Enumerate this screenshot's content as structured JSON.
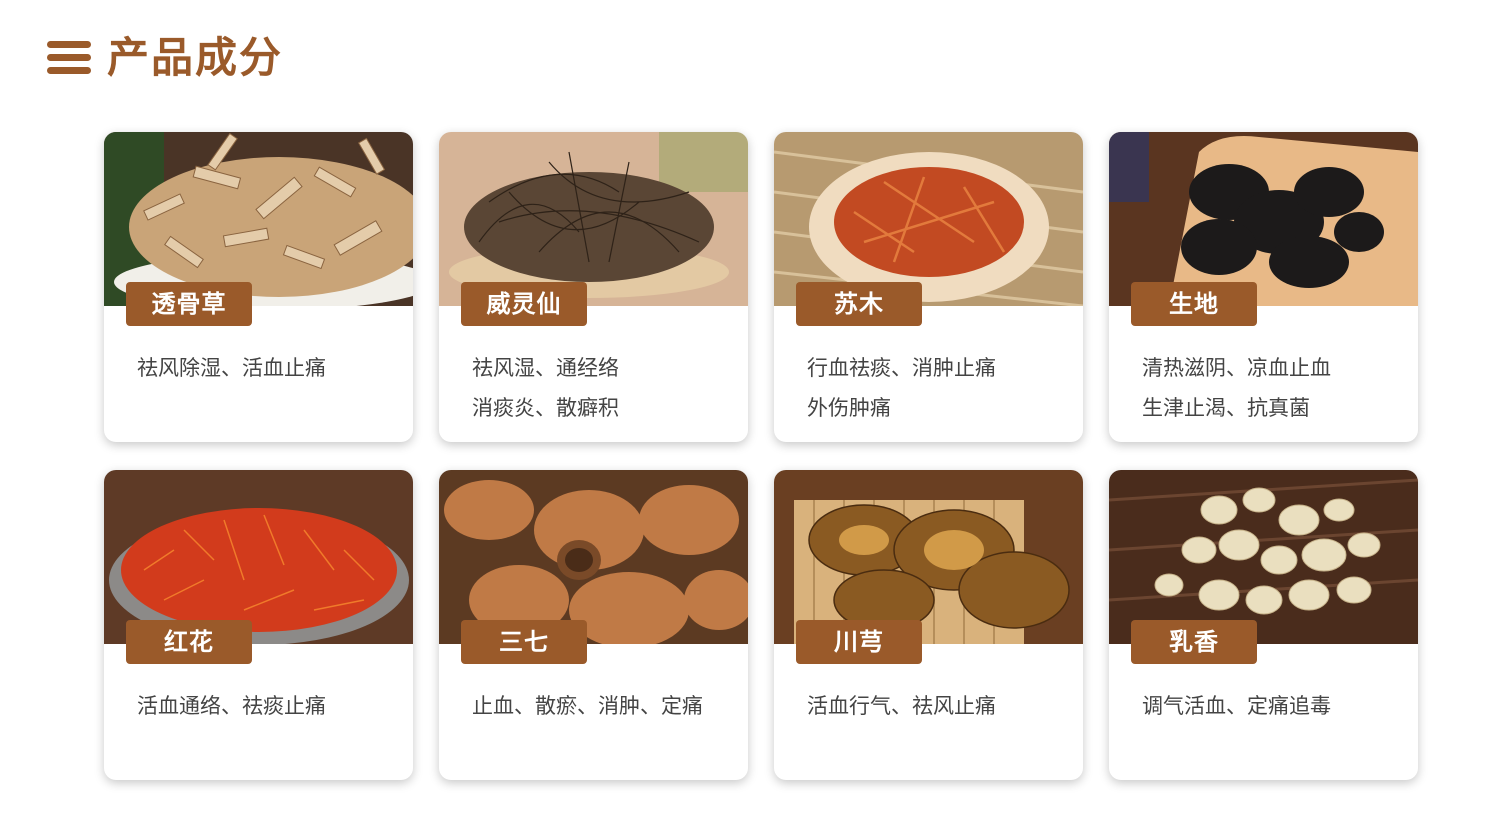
{
  "theme": {
    "accent": "#9a5a2a"
  },
  "header": {
    "title": "产品成分",
    "icon": "menu-icon"
  },
  "ingredients": [
    {
      "name": "透骨草",
      "lines": [
        "祛风除湿、活血止痛",
        ""
      ]
    },
    {
      "name": "威灵仙",
      "lines": [
        "祛风湿、通经络",
        "消痰炎、散癖积"
      ]
    },
    {
      "name": "苏木",
      "lines": [
        "行血祛痰、消肿止痛",
        "外伤肿痛"
      ]
    },
    {
      "name": "生地",
      "lines": [
        "清热滋阴、凉血止血",
        "生津止渴、抗真菌"
      ]
    },
    {
      "name": "红花",
      "lines": [
        "活血通络、祛痰止痛",
        ""
      ]
    },
    {
      "name": "三七",
      "lines": [
        "止血、散瘀、消肿、定痛",
        ""
      ]
    },
    {
      "name": "川芎",
      "lines": [
        "活血行气、祛风止痛",
        ""
      ]
    },
    {
      "name": "乳香",
      "lines": [
        "调气活血、定痛追毒",
        ""
      ]
    }
  ]
}
